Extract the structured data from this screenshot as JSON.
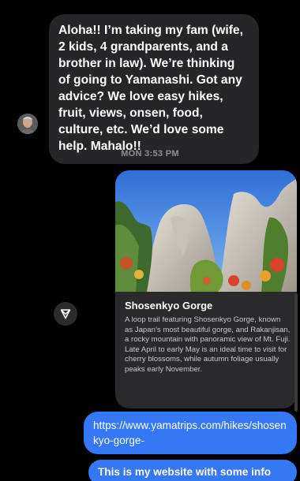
{
  "conversation": {
    "incoming_message": "Aloha!! I’m taking my fam (wife, 2 kids, 4 grandparents, and a brother in law). We’re thinking of going to Yamanashi. Got any advice? We love easy hikes, fruit, views, onsen, food, culture, etc. We’d love some help. Mahalo!!",
    "timestamp": "MON 3:53 PM",
    "link_card": {
      "title": "Shosenkyo Gorge",
      "description": "A loop trail featuring Shosenkyo Gorge, known as Japan’s most beautiful gorge, and Rakanjisan, a rocky mountain with panoramic view of Mt. Fuji. Late April to early May is an ideal time to visit for cherry blossoms, while autumn foliage usually peaks early November."
    },
    "outgoing_link": "https://www.yamatrips.com/hikes/shosenkyo-gorge-",
    "outgoing_message": "This is my website with some info"
  },
  "icons": {
    "avatar": "user-avatar",
    "share": "share-send-icon"
  },
  "colors": {
    "background": "#000000",
    "incoming_bubble": "#262628",
    "outgoing_bubble": "#3478f6",
    "card_bg": "#2a2a2c"
  }
}
